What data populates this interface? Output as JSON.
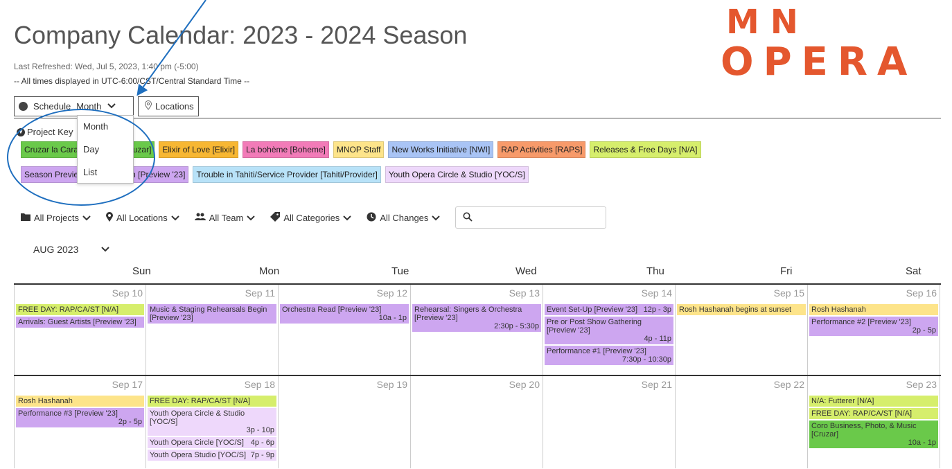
{
  "header": {
    "title": "Company Calendar: 2023 - 2024 Season",
    "last_refreshed": "Last Refreshed: Wed, Jul 5, 2023, 1:40 pm (-5:00)",
    "timezone_note": "-- All times displayed in UTC-6:00/CST/Central Standard Time --",
    "logo_line1": "MN",
    "logo_line2": "OPERA"
  },
  "toolbar": {
    "schedule_label": "Schedule",
    "view_selected": "Month",
    "locations_label": "Locations"
  },
  "view_menu": {
    "items": [
      "Month",
      "Day",
      "List"
    ]
  },
  "project_key": {
    "label": "Project Key",
    "row1": [
      {
        "label": "Cruzar la Cara de la Luna [Cruzar]",
        "color": "#6ac94a"
      },
      {
        "label": "Elixir of Love [Elixir]",
        "color": "#f7b733"
      },
      {
        "label": "La bohème [Boheme]",
        "color": "#f27bb8"
      },
      {
        "label": "MNOP Staff",
        "color": "#fde48a"
      },
      {
        "label": "New Works Initiative [NWI]",
        "color": "#a9c4f5"
      },
      {
        "label": "RAP Activities [RAPS]",
        "color": "#f79a6a"
      },
      {
        "label": "Releases & Free Days [N/A]",
        "color": "#d6ee6c"
      }
    ],
    "row2": [
      {
        "label": "Season Preview 2023 Season [Preview '23]",
        "color": "#cda6f0"
      },
      {
        "label": "Trouble in Tahiti/Service Provider [Tahiti/Provider]",
        "color": "#b8e2f8"
      },
      {
        "label": "Youth Opera Circle & Studio [YOC/S]",
        "color": "#eed8fb"
      }
    ]
  },
  "filters": {
    "projects": "All Projects",
    "locations": "All Locations",
    "team": "All Team",
    "categories": "All Categories",
    "changes": "All Changes"
  },
  "month_label": "AUG 2023",
  "weekdays": [
    "Sun",
    "Mon",
    "Tue",
    "Wed",
    "Thu",
    "Fri",
    "Sat"
  ],
  "weeks": [
    {
      "days": [
        {
          "num": "Sep 10",
          "events": [
            {
              "title": "FREE DAY: RAP/CA/ST [N/A]",
              "time": "",
              "color": "#d6ee6c"
            },
            {
              "title": "Arrivals: Guest Artists [Preview '23]",
              "time": "",
              "color": "#cda6f0"
            }
          ]
        },
        {
          "num": "Sep 11",
          "events": [
            {
              "title": "Music & Staging Rehearsals Begin [Preview '23]",
              "time": "",
              "color": "#cda6f0"
            }
          ]
        },
        {
          "num": "Sep 12",
          "events": [
            {
              "title": "Orchestra Read [Preview '23]",
              "time": "10a - 1p",
              "color": "#cda6f0"
            }
          ]
        },
        {
          "num": "Sep 13",
          "events": [
            {
              "title": "Rehearsal: Singers & Orchestra [Preview '23]",
              "time": "2:30p - 5:30p",
              "color": "#cda6f0"
            }
          ]
        },
        {
          "num": "Sep 14",
          "events": [
            {
              "title": "Event Set-Up [Preview '23]",
              "time": "12p - 3p",
              "color": "#cda6f0",
              "inline": true
            },
            {
              "title": "Pre or Post Show Gathering [Preview '23]",
              "time": "4p - 11p",
              "color": "#cda6f0"
            },
            {
              "title": "Performance #1 [Preview '23]",
              "time": "7:30p - 10:30p",
              "color": "#cda6f0"
            }
          ]
        },
        {
          "num": "Sep 15",
          "events": [
            {
              "title": "Rosh Hashanah begins at sunset",
              "time": "",
              "color": "#fde48a"
            }
          ]
        },
        {
          "num": "Sep 16",
          "events": [
            {
              "title": "Rosh Hashanah",
              "time": "",
              "color": "#fde48a"
            },
            {
              "title": "Performance #2 [Preview '23]",
              "time": "2p - 5p",
              "color": "#cda6f0"
            }
          ]
        }
      ]
    },
    {
      "days": [
        {
          "num": "Sep 17",
          "events": [
            {
              "title": "Rosh Hashanah",
              "time": "",
              "color": "#fde48a"
            },
            {
              "title": "Performance #3 [Preview '23]",
              "time": "2p - 5p",
              "color": "#cda6f0"
            }
          ]
        },
        {
          "num": "Sep 18",
          "events": [
            {
              "title": "FREE DAY: RAP/CA/ST [N/A]",
              "time": "",
              "color": "#d6ee6c"
            },
            {
              "title": "Youth Opera Circle & Studio [YOC/S]",
              "time": "3p - 10p",
              "color": "#eed8fb"
            },
            {
              "title": "Youth Opera Circle [YOC/S]",
              "time": "4p - 6p",
              "color": "#eed8fb",
              "inline": true
            },
            {
              "title": "Youth Opera Studio [YOC/S]",
              "time": "7p - 9p",
              "color": "#eed8fb",
              "inline": true
            }
          ]
        },
        {
          "num": "Sep 19",
          "events": []
        },
        {
          "num": "Sep 20",
          "events": []
        },
        {
          "num": "Sep 21",
          "events": []
        },
        {
          "num": "Sep 22",
          "events": []
        },
        {
          "num": "Sep 23",
          "events": [
            {
              "title": "N/A: Futterer [N/A]",
              "time": "",
              "color": "#d6ee6c"
            },
            {
              "title": "FREE DAY: RAP/CA/ST [N/A]",
              "time": "",
              "color": "#d6ee6c"
            },
            {
              "title": "Coro Business, Photo, & Music [Cruzar]",
              "time": "10a - 1p",
              "color": "#6ac94a"
            }
          ]
        }
      ]
    }
  ]
}
